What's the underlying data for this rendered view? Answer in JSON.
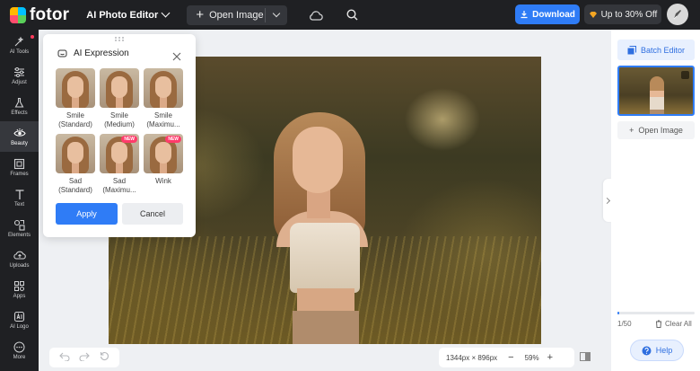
{
  "header": {
    "brand": "fotor",
    "app_name": "AI Photo Editor",
    "open_image_label": "Open Image",
    "download_label": "Download",
    "promo_label": "Up to 30% Off"
  },
  "sidebar": {
    "items": [
      {
        "label": "AI Tools",
        "icon": "magic-wand-icon"
      },
      {
        "label": "Adjust",
        "icon": "sliders-icon"
      },
      {
        "label": "Effects",
        "icon": "flask-icon"
      },
      {
        "label": "Beauty",
        "icon": "eye-icon"
      },
      {
        "label": "Frames",
        "icon": "frame-icon"
      },
      {
        "label": "Text",
        "icon": "text-icon"
      },
      {
        "label": "Elements",
        "icon": "shapes-icon"
      },
      {
        "label": "Uploads",
        "icon": "cloud-upload-icon"
      },
      {
        "label": "Apps",
        "icon": "apps-icon"
      },
      {
        "label": "AI Logo",
        "icon": "ai-logo-icon"
      },
      {
        "label": "More",
        "icon": "more-icon"
      }
    ],
    "active_index": 3
  },
  "expression_panel": {
    "title": "AI Expression",
    "options": [
      {
        "label": "Smile (Standard)",
        "new": false
      },
      {
        "label": "Smile (Medium)",
        "new": false
      },
      {
        "label": "Smile (Maximu...",
        "new": false
      },
      {
        "label": "Sad (Standard)",
        "new": false
      },
      {
        "label": "Sad (Maximu...",
        "new": true
      },
      {
        "label": "Wink",
        "new": true
      }
    ],
    "new_badge": "NEW",
    "apply_label": "Apply",
    "cancel_label": "Cancel"
  },
  "canvas": {
    "dimensions": "1344px × 896px",
    "zoom": "59%"
  },
  "right_panel": {
    "batch_label": "Batch Editor",
    "open_image_label": "Open Image",
    "page_count": "1/50",
    "progress_fraction": 0.02,
    "clear_label": "Clear All",
    "help_label": "Help"
  },
  "colors": {
    "accent": "#2f7cf6",
    "topbar": "#1f2023",
    "new_badge": "#ff3b6b"
  }
}
